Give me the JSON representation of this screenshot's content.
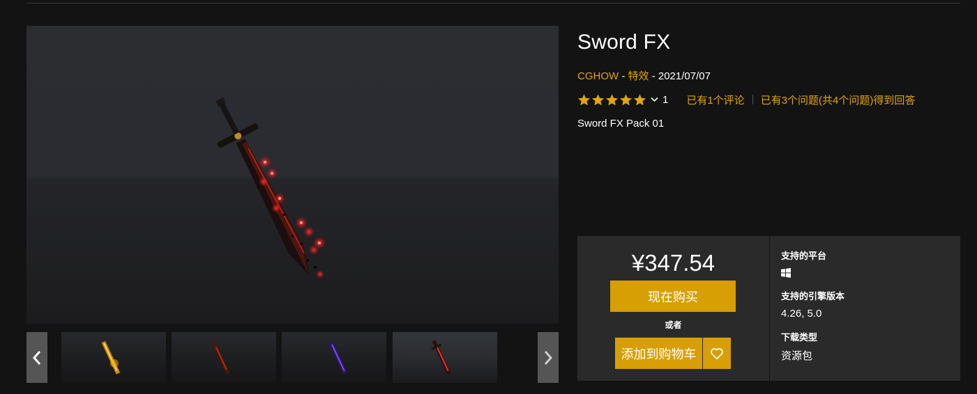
{
  "product": {
    "title": "Sword FX",
    "seller": "CGHOW",
    "sep1": " - ",
    "category": "特效",
    "sep2": " - ",
    "date": "2021/07/07",
    "rating_count": "1",
    "reviews_link": "已有1个评论",
    "questions_link": "已有3个问题(共4个问题)得到回答",
    "description": "Sword FX Pack 01",
    "rating_stars": 5
  },
  "purchase": {
    "price": "¥347.54",
    "buy_now": "现在购买",
    "or": "或者",
    "add_to_cart": "添加到购物车"
  },
  "specs": {
    "platforms_label": "支持的平台",
    "platform_icon": "windows-icon",
    "engine_label": "支持的引擎版本",
    "engine_versions": "4.26, 5.0",
    "download_type_label": "下载类型",
    "download_type": "资源包"
  },
  "gallery": {
    "thumbnail_count": 4
  },
  "colors": {
    "accent": "#e3a50b",
    "button": "#d79f04",
    "panel": "#2a2a2a",
    "background": "#131313"
  }
}
